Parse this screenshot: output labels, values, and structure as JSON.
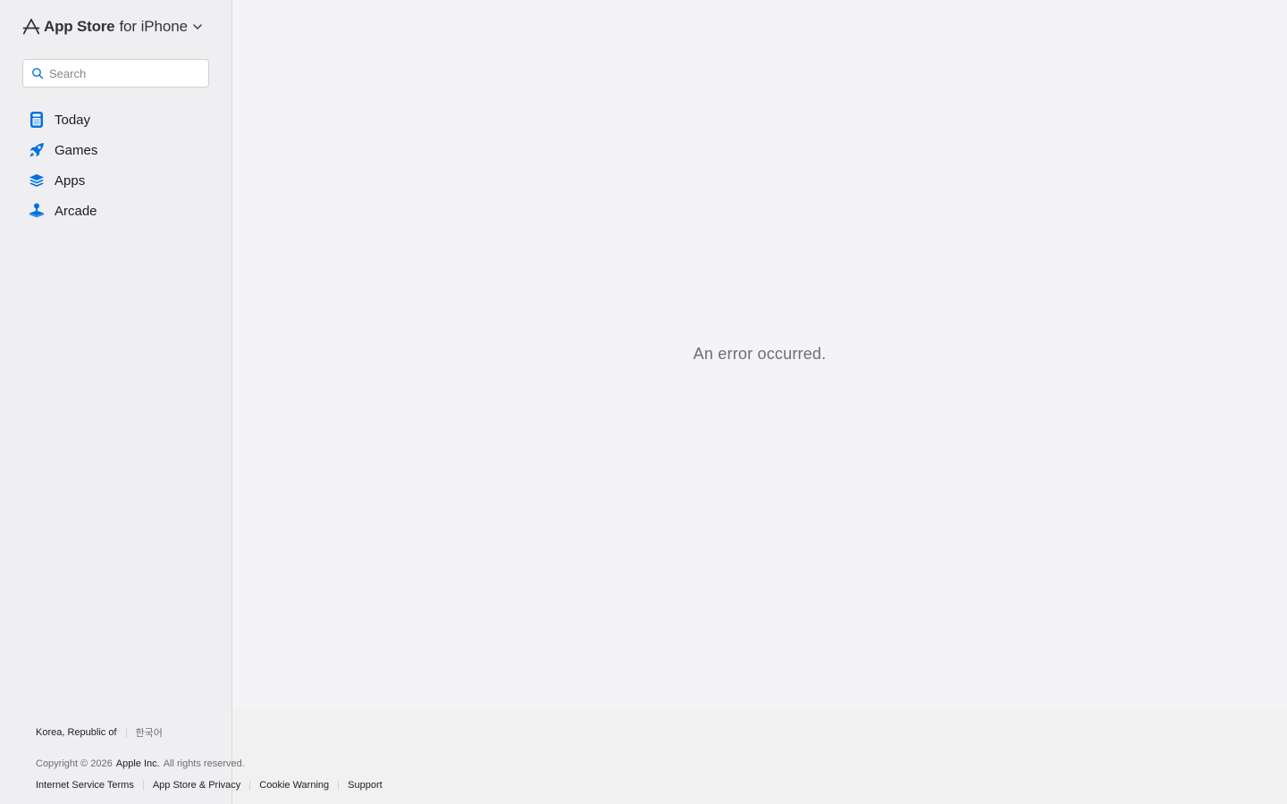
{
  "header": {
    "brand_name": "App Store",
    "platform": "for iPhone",
    "logo_icon": "app-store-icon",
    "chevron_icon": "chevron-down-icon"
  },
  "search": {
    "placeholder": "Search",
    "value": "",
    "icon": "search-icon"
  },
  "sidebar": {
    "items": [
      {
        "label": "Today",
        "icon": "today-icon"
      },
      {
        "label": "Games",
        "icon": "rocket-icon"
      },
      {
        "label": "Apps",
        "icon": "layers-icon"
      },
      {
        "label": "Arcade",
        "icon": "joystick-icon"
      }
    ]
  },
  "main": {
    "error_message": "An error occurred."
  },
  "footer": {
    "country": "Korea, Republic of",
    "language": "한국어",
    "copyright_prefix": "Copyright © 2026",
    "company": "Apple Inc.",
    "rights": "All rights reserved.",
    "links": [
      "Internet Service Terms",
      "App Store & Privacy",
      "Cookie Warning",
      "Support"
    ]
  },
  "colors": {
    "accent": "#0071e3",
    "sidebar_bg": "#efeff2",
    "main_bg": "#f4f4f6",
    "footer_bg": "#f1f1f2",
    "muted_text": "#6e6e73"
  }
}
